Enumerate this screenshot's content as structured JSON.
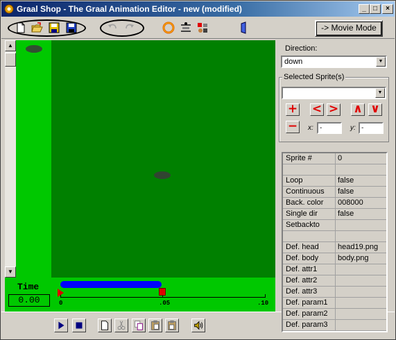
{
  "window": {
    "title": "Graal Shop - The Graal Animation Editor - new (modified)",
    "min_label": "_",
    "max_label": "□",
    "close_label": "×"
  },
  "toolbar": {
    "movie_mode_label": "-> Movie Mode",
    "buttons": [
      "new-icon",
      "open-icon",
      "save-icon",
      "save-as-icon",
      "undo-icon",
      "redo-icon",
      "ring-icon",
      "sprite-tool-icon",
      "sprite-mix-icon",
      "door-icon"
    ]
  },
  "timeline": {
    "time_label": "Time",
    "time_value": "0.00",
    "ticks": [
      "0",
      ".05",
      ".10"
    ],
    "colors": {
      "background": "#00c800",
      "bar": "#0000ff",
      "marker": "#e00000"
    }
  },
  "canvas": {
    "colors": {
      "border": "#00c800",
      "stage": "#008000"
    }
  },
  "panel": {
    "direction_label": "Direction:",
    "direction_value": "down",
    "selected_sprites_label": "Selected Sprite(s)",
    "selected_sprite_value": "",
    "add_label": "+",
    "remove_label": "−",
    "left_label": "<",
    "right_label": ">",
    "up_label": "∧",
    "down_label": "∨",
    "x_label": "x:",
    "x_value": "-",
    "y_label": "y:",
    "y_value": "-"
  },
  "properties": [
    {
      "key": "Sprite #",
      "value": "0"
    },
    {
      "key": "",
      "value": ""
    },
    {
      "key": "Loop",
      "value": "false"
    },
    {
      "key": "Continuous",
      "value": "false"
    },
    {
      "key": "Back. color",
      "value": "008000"
    },
    {
      "key": "Single dir",
      "value": "false"
    },
    {
      "key": "Setbackto",
      "value": ""
    },
    {
      "key": "",
      "value": ""
    },
    {
      "key": "Def. head",
      "value": "head19.png"
    },
    {
      "key": "Def. body",
      "value": "body.png"
    },
    {
      "key": "Def. attr1",
      "value": ""
    },
    {
      "key": "Def. attr2",
      "value": ""
    },
    {
      "key": "Def. attr3",
      "value": ""
    },
    {
      "key": "Def. param1",
      "value": ""
    },
    {
      "key": "Def. param2",
      "value": ""
    },
    {
      "key": "Def. param3",
      "value": ""
    }
  ]
}
